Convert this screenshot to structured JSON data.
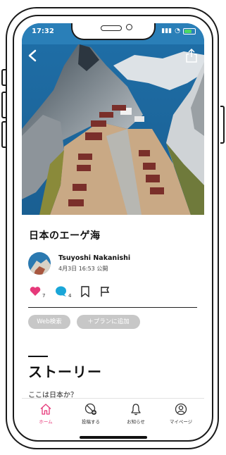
{
  "status_bar": {
    "time": "17:32"
  },
  "post": {
    "title": "日本のエーゲ海",
    "author": "Tsuyoshi Nakanishi",
    "meta": "4月3日 16:53 公開",
    "likes": {
      "count": "7",
      "color": "#e6397a"
    },
    "comments": {
      "count": "4",
      "color": "#1aa6d8"
    }
  },
  "chips": [
    {
      "label": "Web検索"
    },
    {
      "label": "＋プランに追加"
    }
  ],
  "story": {
    "heading": "ストーリー",
    "text": "ここは日本か？"
  },
  "tabbar": {
    "items": [
      {
        "label": "ホーム",
        "icon": "home-icon",
        "active": true
      },
      {
        "label": "投稿する",
        "icon": "post-icon"
      },
      {
        "label": "お知らせ",
        "icon": "bell-icon"
      },
      {
        "label": "マイページ",
        "icon": "profile-icon"
      }
    ]
  },
  "colors": {
    "accent": "#e6397a",
    "chip": "#c7c7c7"
  }
}
